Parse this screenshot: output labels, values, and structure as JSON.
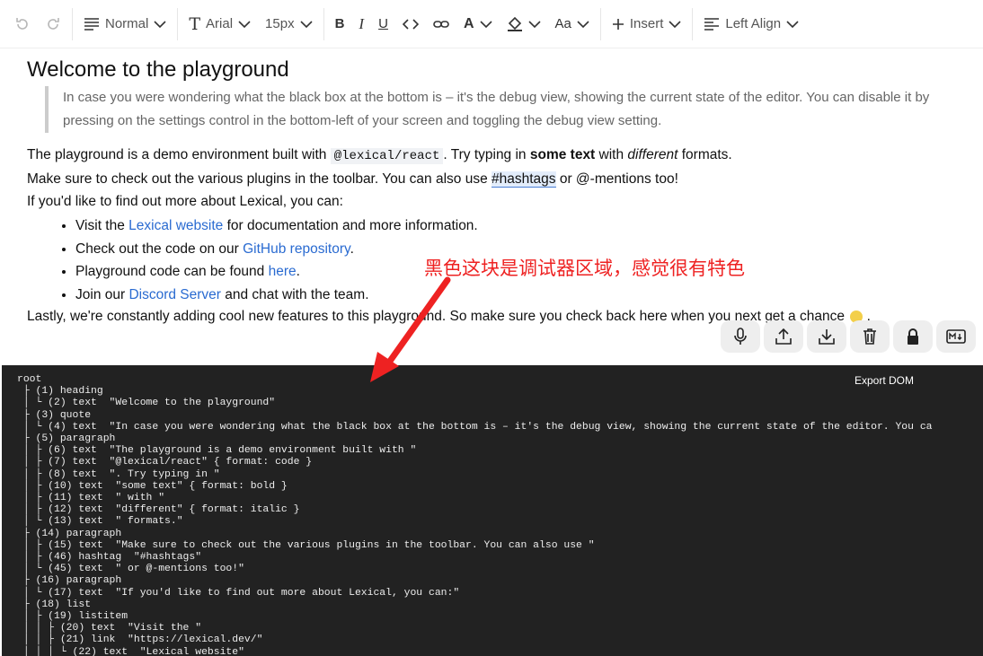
{
  "toolbar": {
    "block_type": "Normal",
    "font_family": "Arial",
    "font_size": "15px",
    "insert_label": "Insert",
    "align_label": "Left Align",
    "case_label": "Aa",
    "font_letter": "T"
  },
  "editor": {
    "heading": "Welcome to the playground",
    "quote": "In case you were wondering what the black box at the bottom is – it's the debug view, showing the current state of the editor. You can disable it by pressing on the settings control in the bottom-left of your screen and toggling the debug view setting.",
    "p1_a": "The playground is a demo environment built with ",
    "p1_code": "@lexical/react",
    "p1_b": ". Try typing in ",
    "p1_bold": "some text",
    "p1_c": " with ",
    "p1_italic": "different",
    "p1_d": " formats.",
    "p2_a": "Make sure to check out the various plugins in the toolbar. You can also use ",
    "p2_hashtag": "#hashtags",
    "p2_b": " or @-mentions too!",
    "p3": "If you'd like to find out more about Lexical, you can:",
    "li1_a": "Visit the ",
    "li1_link": "Lexical website",
    "li1_b": " for documentation and more information.",
    "li2_a": "Check out the code on our ",
    "li2_link": "GitHub repository",
    "li2_b": ".",
    "li3_a": "Playground code can be found ",
    "li3_link": "here",
    "li3_b": ".",
    "li4_a": "Join our ",
    "li4_link": "Discord Server",
    "li4_b": " and chat with the team.",
    "p4_a": "Lastly, we're constantly adding cool new features to this playground. So make sure you check back here when you next get a chance ",
    "p4_b": "."
  },
  "actions": [
    "mic-icon",
    "import-icon",
    "export-icon",
    "trash-icon",
    "lock-icon",
    "markdown-icon"
  ],
  "debug": {
    "export_label": "Export DOM",
    "tree": "root\n ├ (1) heading\n │ └ (2) text  \"Welcome to the playground\"\n ├ (3) quote\n │ └ (4) text  \"In case you were wondering what the black box at the bottom is – it's the debug view, showing the current state of the editor. You ca\n ├ (5) paragraph\n │ ├ (6) text  \"The playground is a demo environment built with \"\n │ ├ (7) text  \"@lexical/react\" { format: code }\n │ ├ (8) text  \". Try typing in \"\n │ ├ (10) text  \"some text\" { format: bold }\n │ ├ (11) text  \" with \"\n │ ├ (12) text  \"different\" { format: italic }\n │ └ (13) text  \" formats.\"\n ├ (14) paragraph\n │ ├ (15) text  \"Make sure to check out the various plugins in the toolbar. You can also use \"\n │ ├ (46) hashtag  \"#hashtags\"\n │ └ (45) text  \" or @-mentions too!\"\n ├ (16) paragraph\n │ └ (17) text  \"If you'd like to find out more about Lexical, you can:\"\n ├ (18) list\n │ ├ (19) listitem\n │ │ ├ (20) text  \"Visit the \"\n │ │ ├ (21) link  \"https://lexical.dev/\"\n │ │ │ └ (22) text  \"Lexical website\""
  },
  "annotation": {
    "text": "黑色这块是调试器区域，感觉很有特色",
    "color": "#ee2222"
  }
}
